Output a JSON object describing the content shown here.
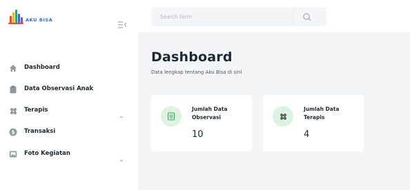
{
  "brand": {
    "name": "AKU BISA",
    "colors": [
      "#e8473a",
      "#f2b33a",
      "#3aa356",
      "#2e6bd0",
      "#8c4bd0"
    ]
  },
  "sidebar": {
    "collapse_icon": "collapse-menu-icon",
    "items": [
      {
        "label": "Dashboard",
        "icon": "home-icon",
        "has_submenu": false
      },
      {
        "label": "Data Observasi Anak",
        "icon": "clipboard-icon",
        "has_submenu": false
      },
      {
        "label": "Terapis",
        "icon": "bandage-icon",
        "has_submenu": true
      },
      {
        "label": "Transaksi",
        "icon": "dollar-icon",
        "has_submenu": false
      },
      {
        "label": "Foto Kegiatan",
        "icon": "photo-icon",
        "has_submenu": true
      }
    ]
  },
  "search": {
    "placeholder": "Search term",
    "value": "",
    "button_icon": "search-icon"
  },
  "main": {
    "title": "Dashboard",
    "subtitle": "Data lengkap tentang Aku Bisa di sini",
    "cards": [
      {
        "label": "Jumlah Data Observasi",
        "value": "10",
        "icon": "clipboard-list-icon"
      },
      {
        "label": "Jumlah Data Terapis",
        "value": "4",
        "icon": "bandage-icon"
      }
    ]
  },
  "colors": {
    "accent_green": "#3aa356",
    "icon_bg_green": "#dcf3e2",
    "sidebar_icon": "#8f989f",
    "page_bg": "#f4f5f7",
    "text_dark": "#1e2a33"
  }
}
